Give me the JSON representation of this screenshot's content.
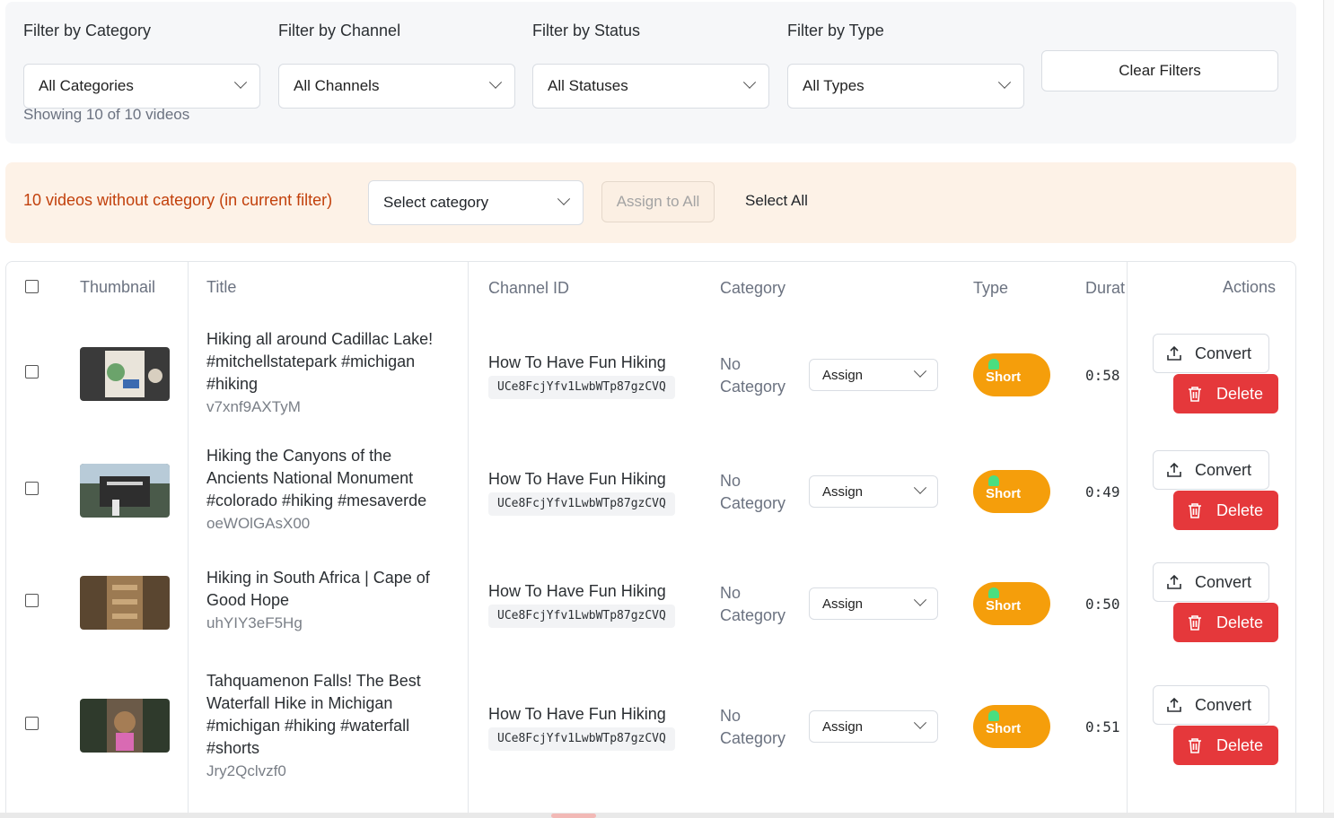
{
  "filters": {
    "category": {
      "label": "Filter by Category",
      "value": "All Categories"
    },
    "channel": {
      "label": "Filter by Channel",
      "value": "All Channels"
    },
    "status": {
      "label": "Filter by Status",
      "value": "All Statuses"
    },
    "type": {
      "label": "Filter by Type",
      "value": "All Types"
    },
    "clear_label": "Clear Filters",
    "showing_text": "Showing 10 of 10 videos"
  },
  "bulk": {
    "message": "10 videos without category (in current filter)",
    "select_value": "Select category",
    "assign_all_label": "Assign to All",
    "select_all_label": "Select All"
  },
  "table": {
    "headers": {
      "thumbnail": "Thumbnail",
      "title": "Title",
      "channel_id": "Channel ID",
      "category": "Category",
      "type": "Type",
      "duration": "Durat",
      "actions": "Actions"
    },
    "rows": [
      {
        "title": "Hiking all around Cadillac Lake! #mitchellstatepark #michigan #hiking",
        "video_id": "v7xnf9AXTyM",
        "channel_name": "How To Have Fun Hiking",
        "channel_id": "UCe8FcjYfv1LwbWTp87gzCVQ",
        "category": "No Category",
        "assign_label": "Assign",
        "type": "Short",
        "duration": "0:58",
        "convert_label": "Convert",
        "delete_label": "Delete"
      },
      {
        "title": "Hiking the Canyons of the Ancients National Monument #colorado #hiking #mesaverde",
        "video_id": "oeWOlGAsX00",
        "channel_name": "How To Have Fun Hiking",
        "channel_id": "UCe8FcjYfv1LwbWTp87gzCVQ",
        "category": "No Category",
        "assign_label": "Assign",
        "type": "Short",
        "duration": "0:49",
        "convert_label": "Convert",
        "delete_label": "Delete"
      },
      {
        "title": "Hiking in South Africa | Cape of Good Hope",
        "video_id": "uhYIY3eF5Hg",
        "channel_name": "How To Have Fun Hiking",
        "channel_id": "UCe8FcjYfv1LwbWTp87gzCVQ",
        "category": "No Category",
        "assign_label": "Assign",
        "type": "Short",
        "duration": "0:50",
        "convert_label": "Convert",
        "delete_label": "Delete"
      },
      {
        "title": "Tahquamenon Falls! The Best Waterfall Hike in Michigan #michigan #hiking #waterfall #shorts",
        "video_id": "Jry2Qclvzf0",
        "channel_name": "How To Have Fun Hiking",
        "channel_id": "UCe8FcjYfv1LwbWTp87gzCVQ",
        "category": "No Category",
        "assign_label": "Assign",
        "type": "Short",
        "duration": "0:51",
        "convert_label": "Convert",
        "delete_label": "Delete"
      }
    ]
  },
  "colors": {
    "accent_warning": "#c2410c",
    "type_pill": "#f59e0b",
    "delete": "#e5383b"
  },
  "icons": {
    "select": "chevron-down-icon",
    "convert": "upload-icon",
    "delete": "trash-icon",
    "type": "tree-icon"
  }
}
